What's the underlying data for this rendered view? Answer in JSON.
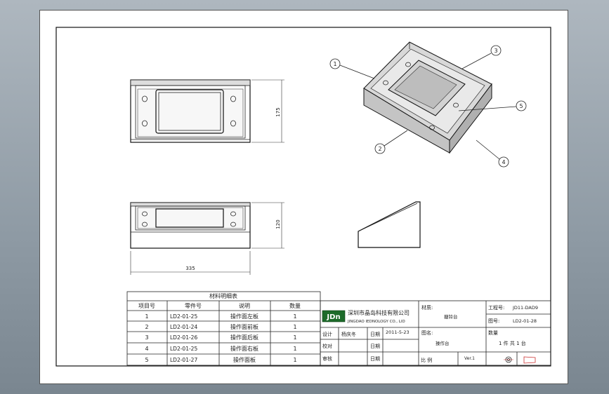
{
  "views": {
    "front_dimension": "175",
    "side_dimension": "120",
    "width_dimension": "335"
  },
  "balloons": [
    "1",
    "2",
    "3",
    "4",
    "5"
  ],
  "bom": {
    "title": "材料明细表",
    "headers": [
      "项目号",
      "零件号",
      "说明",
      "数量"
    ],
    "rows": [
      {
        "item": "1",
        "part": "LD2-01-25",
        "desc": "操作面左板",
        "qty": "1"
      },
      {
        "item": "2",
        "part": "LD2-01-24",
        "desc": "操作面前板",
        "qty": "1"
      },
      {
        "item": "3",
        "part": "LD2-01-26",
        "desc": "操作面后板",
        "qty": "1"
      },
      {
        "item": "4",
        "part": "LD2-01-25",
        "desc": "操作面右板",
        "qty": "1"
      },
      {
        "item": "5",
        "part": "LD2-01-27",
        "desc": "操作面板",
        "qty": "1"
      }
    ]
  },
  "title_block": {
    "logo": "JDn",
    "company_cn": "深圳市晶岛科技有限公司",
    "company_en": "JINGDAO IEDNOLOGY CO., LID",
    "material_label": "材质:",
    "material_value": "搪铃台",
    "project_label": "工程号:",
    "project_value": "JD11-DAD9",
    "drawing_no_label": "图号:",
    "drawing_no_value": "LD2-01-28",
    "design_label": "设计",
    "designer": "杨庆冬",
    "date_label": "日期",
    "date_value": "2011-5-23",
    "name_label": "图名:",
    "name_value": "操作台",
    "qty_label": "数量",
    "qty_value": "1 件  共 1 台",
    "check_label": "校对",
    "date_label2": "日期",
    "approve_label": "审核",
    "date_label3": "日期",
    "scale_label": "比 例",
    "version_label": "Ver.1"
  }
}
